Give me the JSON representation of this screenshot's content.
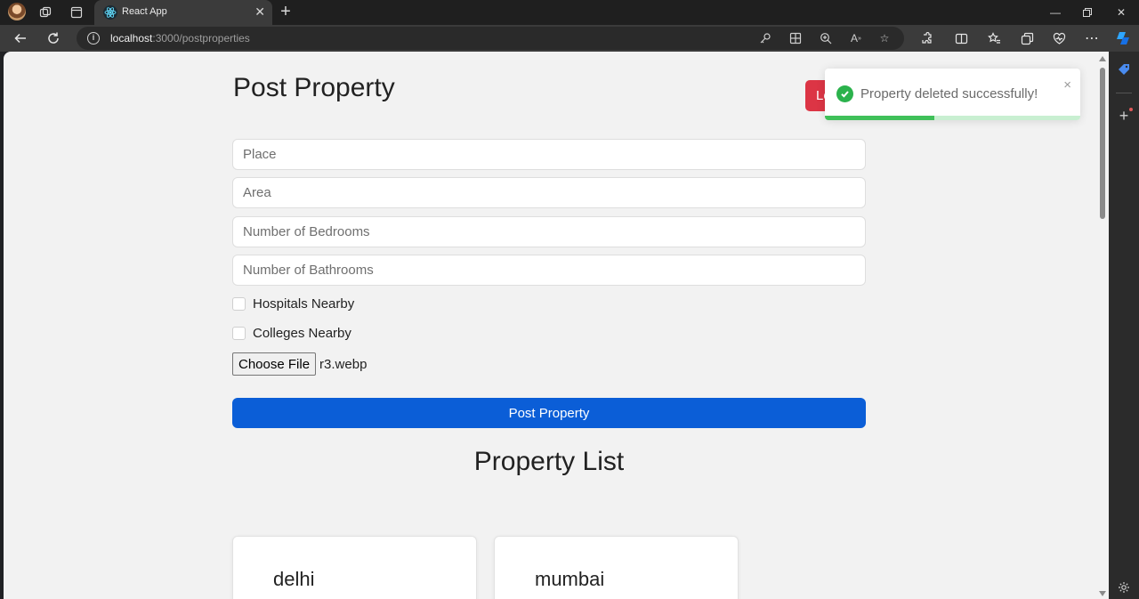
{
  "browser": {
    "tab_title": "React App",
    "url_host": "localhost",
    "url_path": ":3000/postproperties"
  },
  "page": {
    "title": "Post Property",
    "logout_label": "Logout",
    "form": {
      "place_placeholder": "Place",
      "area_placeholder": "Area",
      "bedrooms_placeholder": "Number of Bedrooms",
      "bathrooms_placeholder": "Number of Bathrooms",
      "hospitals_label": "Hospitals Nearby",
      "hospitals_checked": false,
      "colleges_label": "Colleges Nearby",
      "colleges_checked": false,
      "choose_file_label": "Choose File",
      "file_name": "r3.webp",
      "submit_label": "Post Property"
    },
    "list_title": "Property List",
    "properties": [
      {
        "place": "delhi"
      },
      {
        "place": "mumbai"
      }
    ]
  },
  "toast": {
    "message": "Property deleted successfully!",
    "close_glyph": "×",
    "progress_fraction": 0.43,
    "success_color": "#3fc059"
  },
  "colors": {
    "logout": "#dc3545",
    "submit": "#0b5ed7"
  }
}
